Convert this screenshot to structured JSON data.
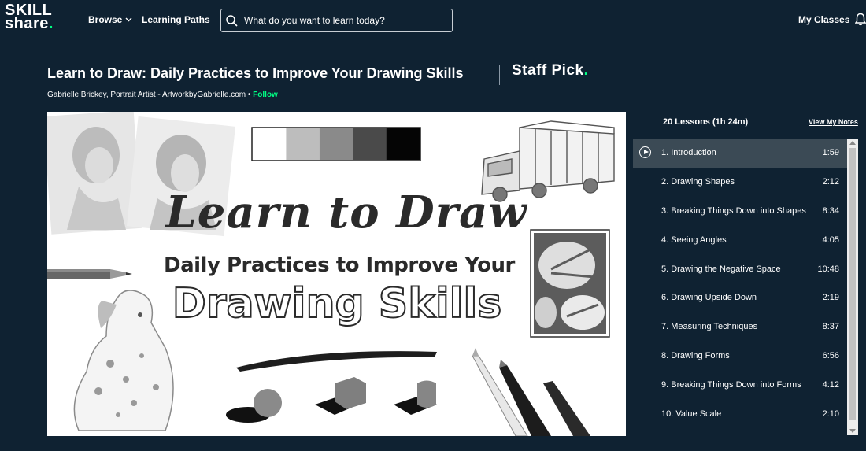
{
  "nav": {
    "logo_line1": "SKILL",
    "logo_line2": "share",
    "logo_dot": ".",
    "browse": "Browse",
    "learning_paths": "Learning Paths",
    "search_placeholder": "What do you want to learn today?",
    "my_classes": "My Classes"
  },
  "course": {
    "title": "Learn to Draw: Daily Practices to Improve Your Drawing Skills",
    "staff_pick": "Staff Pick",
    "staff_pick_dot": ".",
    "author": "Gabrielle Brickey, Portrait Artist - ArtworkbyGabrielle.com",
    "bullet": " • ",
    "follow": "Follow"
  },
  "video": {
    "title_line1": "Learn to Draw",
    "title_line2": "Daily Practices to Improve Your",
    "title_line3": "Drawing Skills",
    "swatches": [
      "#ffffff",
      "#bdbdbd",
      "#8a8a8a",
      "#4a4a4a",
      "#050505"
    ]
  },
  "lessons": {
    "header": "20 Lessons (1h 24m)",
    "notes_link": "View My Notes",
    "items": [
      {
        "name": "1. Introduction",
        "time": "1:59"
      },
      {
        "name": "2. Drawing Shapes",
        "time": "2:12"
      },
      {
        "name": "3. Breaking Things Down into Shapes",
        "time": "8:34"
      },
      {
        "name": "4. Seeing Angles",
        "time": "4:05"
      },
      {
        "name": "5. Drawing the Negative Space",
        "time": "10:48"
      },
      {
        "name": "6. Drawing Upside Down",
        "time": "2:19"
      },
      {
        "name": "7. Measuring Techniques",
        "time": "8:37"
      },
      {
        "name": "8. Drawing Forms",
        "time": "6:56"
      },
      {
        "name": "9. Breaking Things Down into Forms",
        "time": "4:12"
      },
      {
        "name": "10. Value Scale",
        "time": "2:10"
      }
    ]
  },
  "colors": {
    "background": "#0f2232",
    "accent": "#00ff84",
    "active_lesson": "#3b4a55"
  }
}
